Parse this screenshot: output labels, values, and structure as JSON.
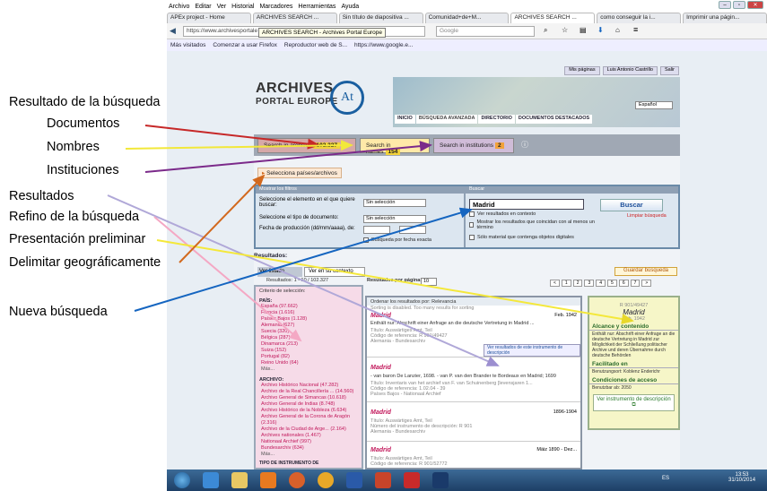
{
  "browser": {
    "menu": [
      "Archivo",
      "Editar",
      "Ver",
      "Historial",
      "Marcadores",
      "Herramientas",
      "Ayuda"
    ],
    "tabs": [
      "APEx project - Home",
      "ARCHIVES SEARCH ...",
      "Sin título de diapositiva ...",
      "Comunidad+de+M...",
      "ARCHIVES SEARCH ...",
      "como conseguir la i...",
      "Imprimir una págin..."
    ],
    "url": "https://www.archivesportale",
    "tooltip": "ARCHIVES SEARCH - Archives Portal Europe",
    "search_placeholder": "Google",
    "bookmarks": [
      "Más visitados",
      "Comenzar a usar Firefox",
      "Reproductor web de S...",
      "https://www.google.e..."
    ]
  },
  "site": {
    "top_links": [
      "Mis páginas",
      "Luis Antonio Castrillo",
      "Salir"
    ],
    "logo_line1": "ARCHIVES",
    "logo_line2": "PORTAL EUROPE",
    "logo_mark": "At",
    "nav": [
      "INICIO",
      "BÚSQUEDA AVANZADA",
      "DIRECTORIO",
      "DOCUMENTOS DESTACADOS"
    ],
    "language": "Español"
  },
  "results_tabs": {
    "archives": {
      "label": "Search in archives",
      "count": "102.327"
    },
    "names": {
      "label": "Search in names",
      "count": "154"
    },
    "institutions": {
      "label": "Search in institutions",
      "count": "2"
    }
  },
  "selecciona": "Selecciona países/archivos",
  "filters": {
    "header_left": "Mostrar los filtros",
    "header_right": "Buscar",
    "f1": "Seleccione el elemento en el que quiere buscar:",
    "f2": "Seleccione el tipo de documento:",
    "f3": "Fecha de producción (dd/mm/aaaa), de:",
    "sel": "Sin selección",
    "exact": "Búsqueda por fecha exacta",
    "query": "Madrid",
    "buscar": "Buscar",
    "limpiar": "Limpiar búsqueda",
    "opt1": "Ver resultados en contexto",
    "opt2": "Mostrar los resultados que coincidan con al menos un término",
    "opt3": "Sólo material que contenga objetos digitales"
  },
  "results": {
    "title": "Resultados:",
    "tab_list": "Ver listado",
    "tab_context": "Ver en su contexto",
    "range": "Resultados: 1 - 10 / 102.327",
    "per_page": "Resultados por página:",
    "per_page_val": "10",
    "save": "Guardar búsqueda",
    "pages": [
      "<",
      "1",
      "2",
      "3",
      "4",
      "5",
      "6",
      "7",
      ">"
    ]
  },
  "criteria": {
    "title": "Criterio de selección:",
    "pais_head": "PAÍS:",
    "paises": [
      "España (97.662)",
      "Francia (1.616)",
      "Países Bajos (1.128)",
      "Alemania (627)",
      "Suecia (320)",
      "Bélgica (287)",
      "Dinamarca (213)",
      "Suiza (152)",
      "Portugal (82)",
      "Reino Unido (64)",
      "Más..."
    ],
    "archivo_head": "ARCHIVO:",
    "archivos": [
      "Archivo Histórico Nacional (47.282)",
      "Archivo de la Real Chancillería ... (14.560)",
      "Archivo General de Simancas (10.618)",
      "Archivo General de Indias (8.748)",
      "Archivo Histórico de la Nobleza (6.634)",
      "Archivo General de la Corona de Aragón (2.316)",
      "Archivo de la Ciudad de Arge... (2.164)",
      "Archives nationales (1.467)",
      "Nationaal Archief (997)",
      "Bundesarchiv (634)",
      "Más..."
    ],
    "tipo_head": "TIPO DE INSTRUMENTO DE"
  },
  "list": {
    "order": "Ordenar los resultados por: Relevancia",
    "order_note": "Sorting is disabled. Too many results for sorting",
    "r1_title": "Madrid",
    "r1_date": "Feb. 1942",
    "r1_text": "Enthält nur: Abschrift einer Anfrage an die deutsche Vertretung in Madrid ...",
    "r1_meta1": "Título: Auswärtiges Amt, Teil",
    "r1_meta2": "Código de referencia: R 901/49427",
    "r1_meta3": "Alemania - Bundesarchiv",
    "r1_btn": "Ver resultados de este instrumento de descripción",
    "r2_title": "Madrid",
    "r2_text": "- van baron De Lanzier, 1698. - van P. van den Brander te Bordeaux en Madrid; 1699",
    "r2_meta1": "Título: Inventaris van het archief van F. van Schuinenberg [levensjaren 1...",
    "r2_meta2": "Código de referencia: 1.02.04 - 39",
    "r2_meta3": "Países Bajos - Nationaal Archief",
    "r3_title": "Madrid",
    "r3_date": "1896-1904",
    "r3_meta1": "Título: Auswärtiges Amt, Teil",
    "r3_meta2": "Número del instrumento de descripción: R 901",
    "r3_meta3": "Alemania - Bundesarchiv",
    "r4_title": "Madrid",
    "r4_date": "Mäiz 1890 - Dez...",
    "r4_meta1": "Título: Auswärtiges Amt, Teil",
    "r4_meta2": "Código de referencia: R 901/52772"
  },
  "preview": {
    "ref": "R 901/49427",
    "title": "Madrid",
    "date": "Feb. 1942",
    "h1": "Alcance y contenido",
    "body": "Enthält nur: Abschrift einer Anfrage an die deutsche Vertretung in Madrid zur Möglichkeit der Schließung politischer Archive und deren Übernahme durch deutsche Behörden",
    "h2": "Facilitado en",
    "h2_text": "Benutzungsort: Koblenz Enderichr",
    "h3": "Condiciones de acceso",
    "h3_text": "Benutzbar ab: 2050",
    "btn": "Ver instrumento de descripción"
  },
  "annotations": {
    "a1": "Resultado de la búsqueda",
    "a2": "Documentos",
    "a3": "Nombres",
    "a4": "Instituciones",
    "a5": "Resultados",
    "a6": "Refino de la búsqueda",
    "a7": "Presentación preliminar",
    "a8": "Delimitar geográficamente",
    "a9": "Nueva búsqueda"
  },
  "arrow_colors": {
    "documentos": "#c62828",
    "nombres": "#f2e83a",
    "instituciones": "#7b2a8a",
    "resultados": "#b0a8d8",
    "refino": "#f4a8c4",
    "presentacion": "#f4e83a",
    "delimitar": "#d2691e",
    "nueva": "#1565c0"
  },
  "taskbar": {
    "lang": "ES",
    "time": "13:53",
    "date": "31/10/2014"
  }
}
